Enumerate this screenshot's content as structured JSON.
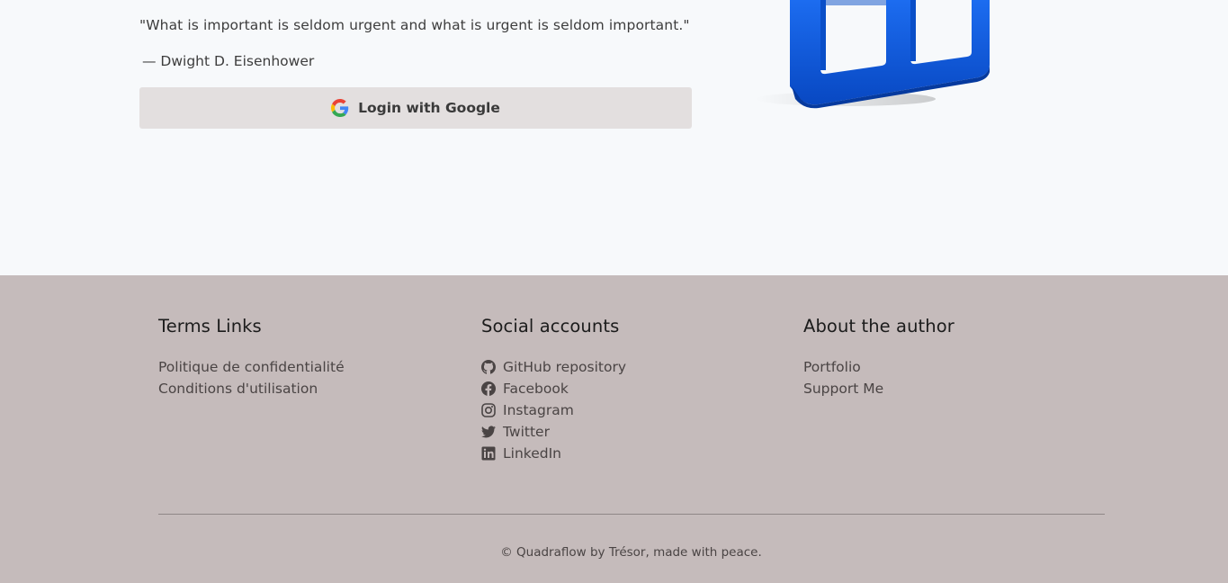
{
  "hero": {
    "quote": "\"What is important is seldom urgent and what is urgent is seldom important.\"",
    "author": "— Dwight D. Eisenhower",
    "login_button": "Login with Google"
  },
  "footer": {
    "terms": {
      "title": "Terms Links",
      "links": [
        "Politique de confidentialité",
        "Conditions d'utilisation"
      ]
    },
    "social": {
      "title": "Social accounts",
      "links": [
        {
          "label": "GitHub repository",
          "icon": "github-icon"
        },
        {
          "label": "Facebook",
          "icon": "facebook-icon"
        },
        {
          "label": "Instagram",
          "icon": "instagram-icon"
        },
        {
          "label": "Twitter",
          "icon": "twitter-icon"
        },
        {
          "label": "LinkedIn",
          "icon": "linkedin-icon"
        }
      ]
    },
    "about": {
      "title": "About the author",
      "links": [
        "Portfolio",
        "Support Me"
      ]
    },
    "copyright": "© Quadraflow by Trésor, made with peace."
  },
  "colors": {
    "page_bg": "#f7f9fb",
    "button_bg": "#e3dfdf",
    "footer_bg": "#c5bbbb",
    "illustration_blue": "#0b5bd8"
  }
}
